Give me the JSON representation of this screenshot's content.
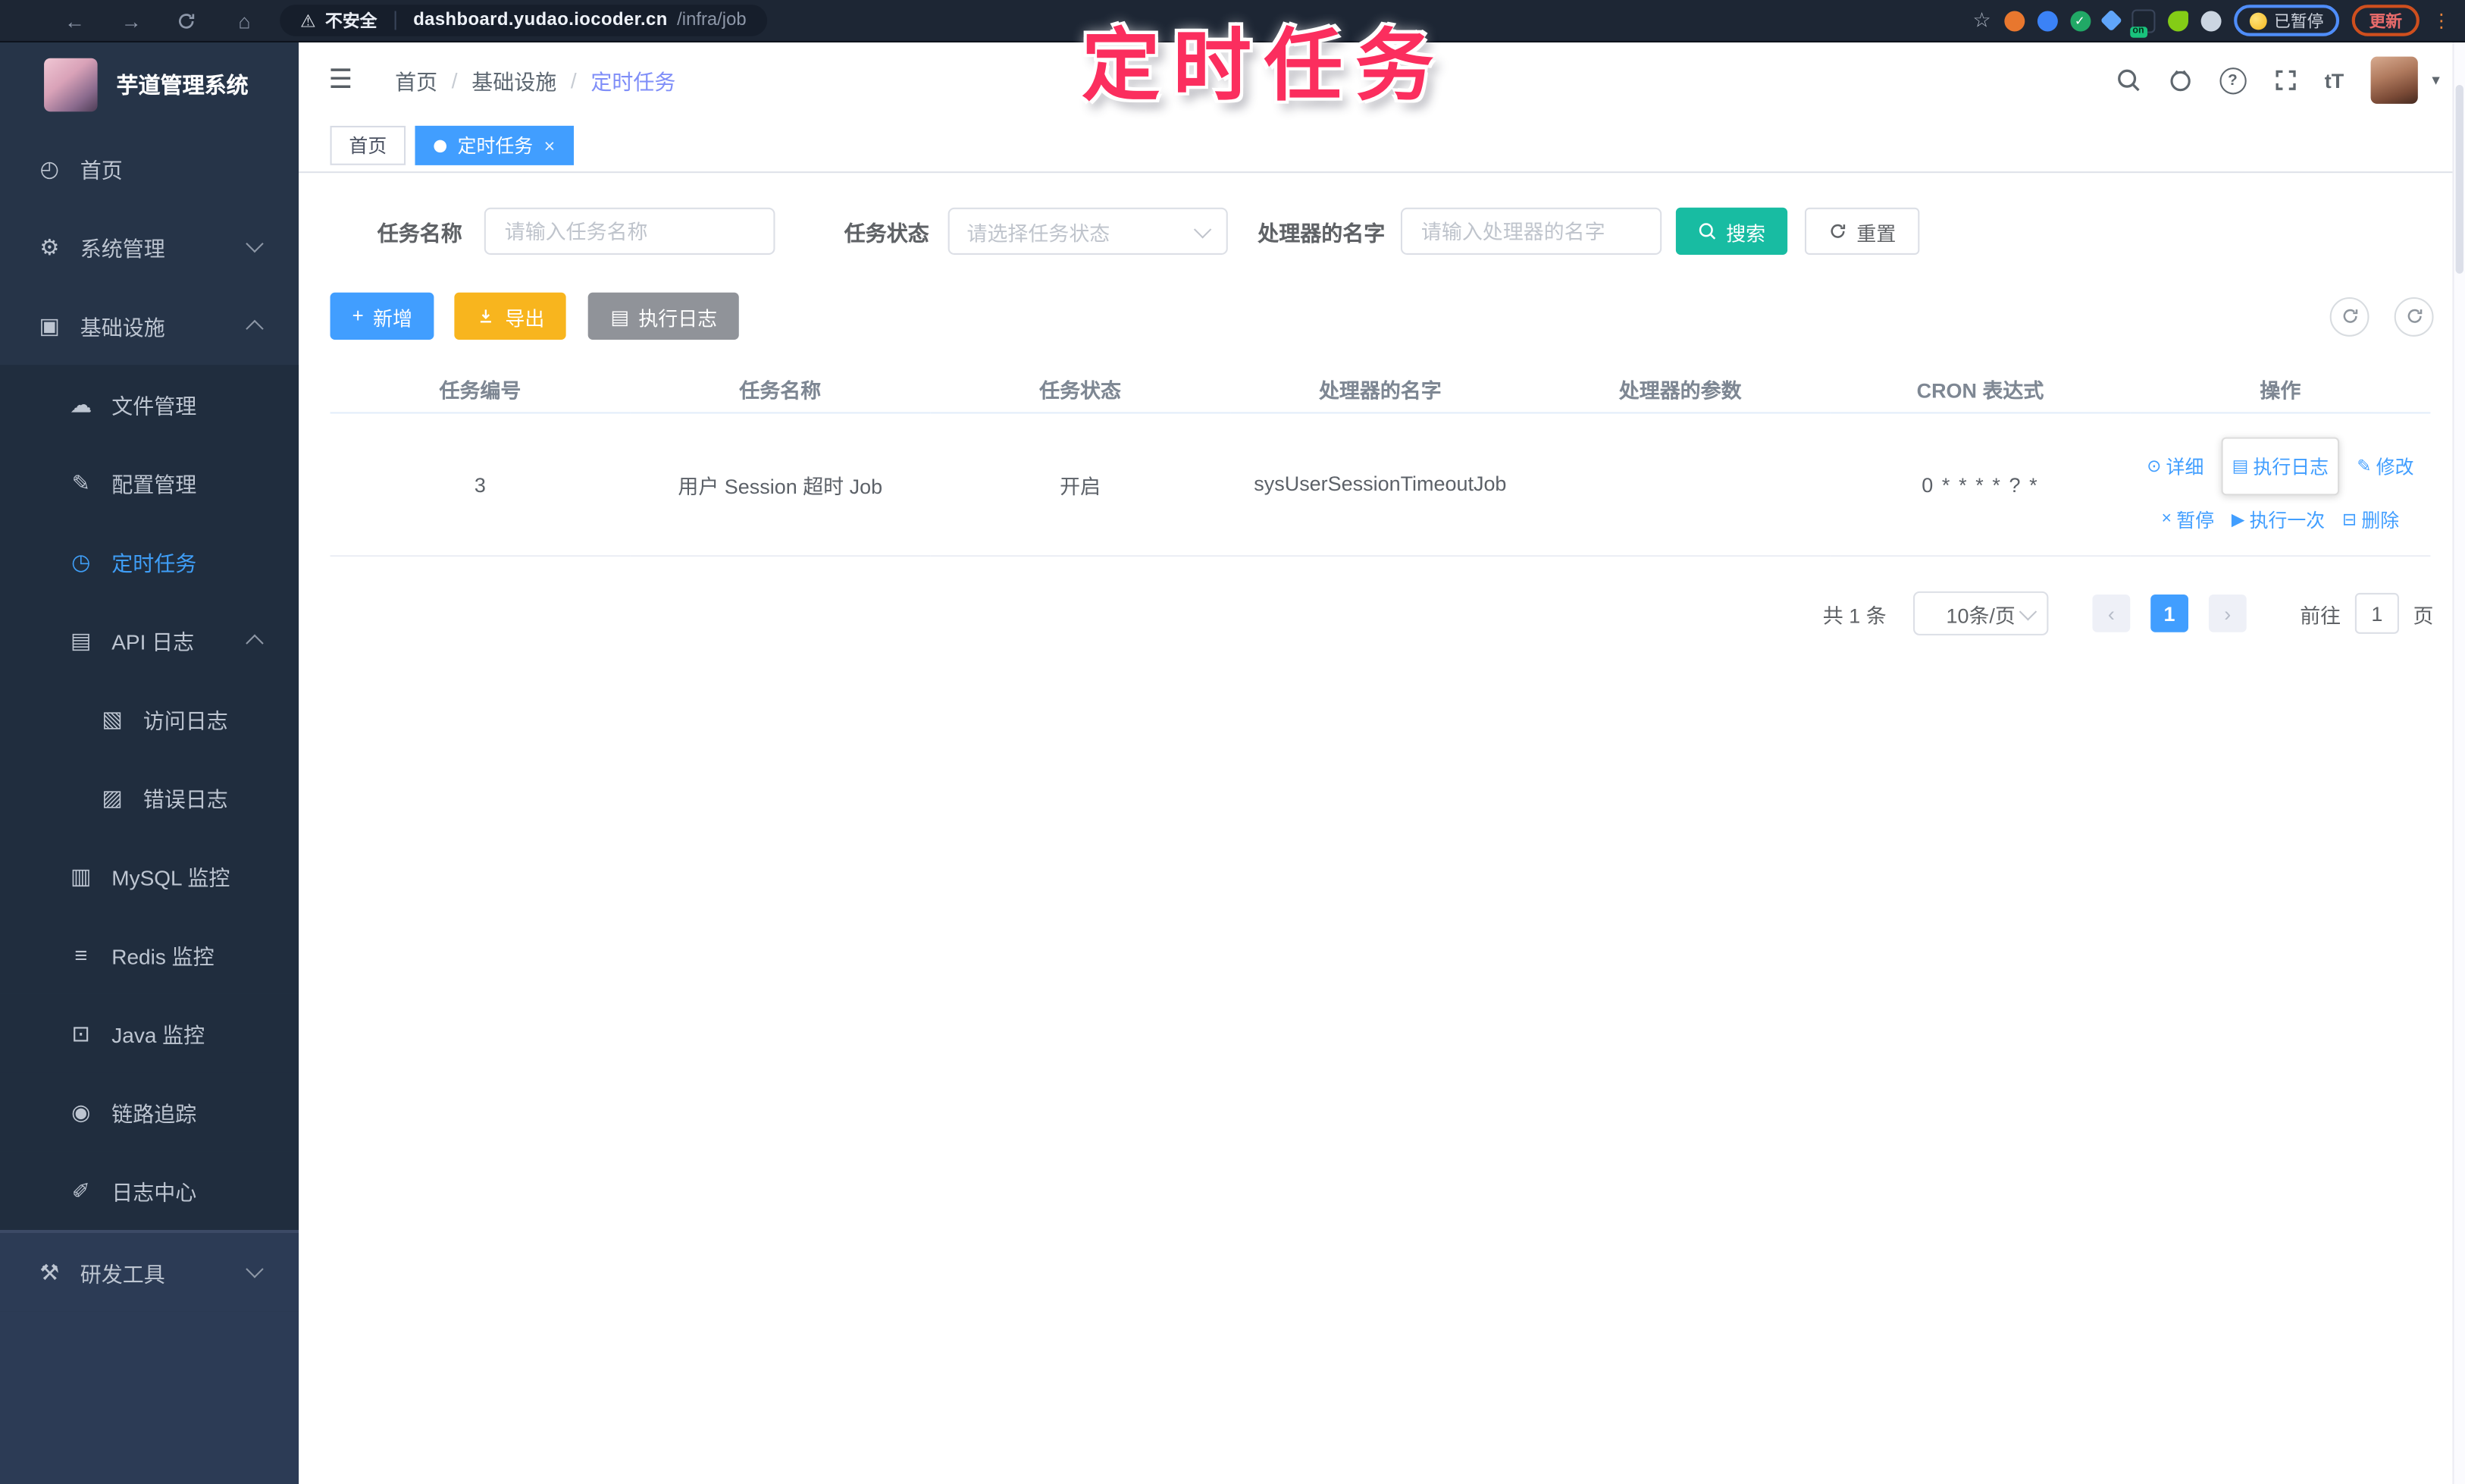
{
  "annotation": {
    "text": "定时任务"
  },
  "browser": {
    "security_label": "不安全",
    "url_host": "dashboard.yudao.iocoder.cn",
    "url_path": "/infra/job",
    "ext_on_badge": "on",
    "ext_check": "✓",
    "paused_badge_label": "已暂停",
    "update_button_label": "更新"
  },
  "header": {
    "breadcrumb": [
      "首页",
      "基础设施",
      "定时任务"
    ],
    "separator": "/",
    "question_mark": "?",
    "font_size_label": "tT"
  },
  "tabs": {
    "home": "首页",
    "active": "定时任务"
  },
  "sidebar": {
    "title": "芋道管理系统",
    "items": [
      {
        "label": "首页"
      },
      {
        "label": "系统管理"
      },
      {
        "label": "基础设施"
      },
      {
        "label": "文件管理"
      },
      {
        "label": "配置管理"
      },
      {
        "label": "定时任务"
      },
      {
        "label": "API 日志"
      },
      {
        "label": "访问日志"
      },
      {
        "label": "错误日志"
      },
      {
        "label": "MySQL 监控"
      },
      {
        "label": "Redis 监控"
      },
      {
        "label": "Java 监控"
      },
      {
        "label": "链路追踪"
      },
      {
        "label": "日志中心"
      },
      {
        "label": "研发工具"
      }
    ]
  },
  "filters": {
    "name_label": "任务名称",
    "name_placeholder": "请输入任务名称",
    "status_label": "任务状态",
    "status_placeholder": "请选择任务状态",
    "handler_label": "处理器的名字",
    "handler_placeholder": "请输入处理器的名字",
    "search_label": "搜索",
    "reset_label": "重置"
  },
  "toolbar": {
    "add_label": "新增",
    "export_label": "导出",
    "exec_log_label": "执行日志"
  },
  "table": {
    "headers": [
      "任务编号",
      "任务名称",
      "任务状态",
      "处理器的名字",
      "处理器的参数",
      "CRON 表达式",
      "操作"
    ],
    "row": {
      "id": "3",
      "name": "用户 Session 超时 Job",
      "status": "开启",
      "handler": "sysUserSessionTimeoutJob",
      "param": "",
      "cron": "0 * * * * ? *",
      "ops": [
        "详细",
        "执行日志",
        "修改",
        "暂停",
        "执行一次",
        "删除"
      ]
    }
  },
  "pagination": {
    "total_label": "共 1 条",
    "page_size": "10条/页",
    "current_page": "1",
    "goto_label": "前往",
    "goto_value": "1",
    "page_unit_label": "页"
  },
  "icons": {
    "back": "←",
    "forward": "→",
    "home": "⌂",
    "star": "☆",
    "more": "⋮",
    "warning": "⚠",
    "hamburger": "☰",
    "caret_down": "▾",
    "menu_dashboard": "◴",
    "menu_gear": "⚙",
    "menu_infra": "▣",
    "menu_cloud": "☁",
    "menu_config": "✎",
    "menu_timer": "◷",
    "menu_api_log": "▤",
    "menu_access_log": "▧",
    "menu_error_log": "▨",
    "menu_mysql": "▥",
    "menu_redis": "≡",
    "menu_java": "⊡",
    "menu_trace": "◉",
    "menu_log_center": "✐",
    "menu_tools": "⚒",
    "plus": "+",
    "exec_log_btn": "▤",
    "op_detail": "⊙",
    "op_log": "▤",
    "op_edit": "✎",
    "op_pause": "×",
    "op_run": "▶",
    "op_delete": "⊟",
    "prev": "‹",
    "next": "›",
    "close": "×"
  },
  "colors": {
    "primary": "#419eff",
    "search_teal": "#18bca2",
    "export_amber": "#f8b51e",
    "gray_button": "#909399",
    "annotation_pink": "#fb2e5e",
    "sidebar_bg": "#263448"
  }
}
